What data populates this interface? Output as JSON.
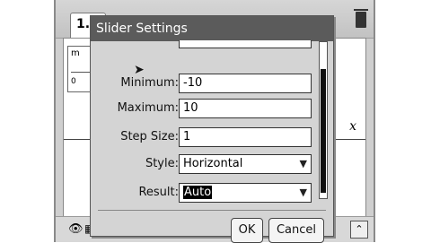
{
  "document": {
    "tab_label": "1.",
    "axis_label": "x",
    "slider_var": "m",
    "slider_ticks": "0    "
  },
  "dialog": {
    "title": "Slider Settings",
    "fields": {
      "minimum": {
        "label": "Minimum:",
        "value": "-10"
      },
      "maximum": {
        "label": "Maximum:",
        "value": "10"
      },
      "step_size": {
        "label": "Step Size:",
        "value": "1"
      },
      "style": {
        "label": "Style:",
        "value": "Horizontal"
      },
      "result": {
        "label": "Result:",
        "value": "Auto"
      }
    },
    "buttons": {
      "ok": "OK",
      "cancel": "Cancel"
    }
  },
  "icons": {
    "trash": "trash-icon",
    "eye": "eye-icon",
    "grid": "grid-icon",
    "expand": "expand-icon",
    "dropdown": "chevron-down-icon"
  }
}
